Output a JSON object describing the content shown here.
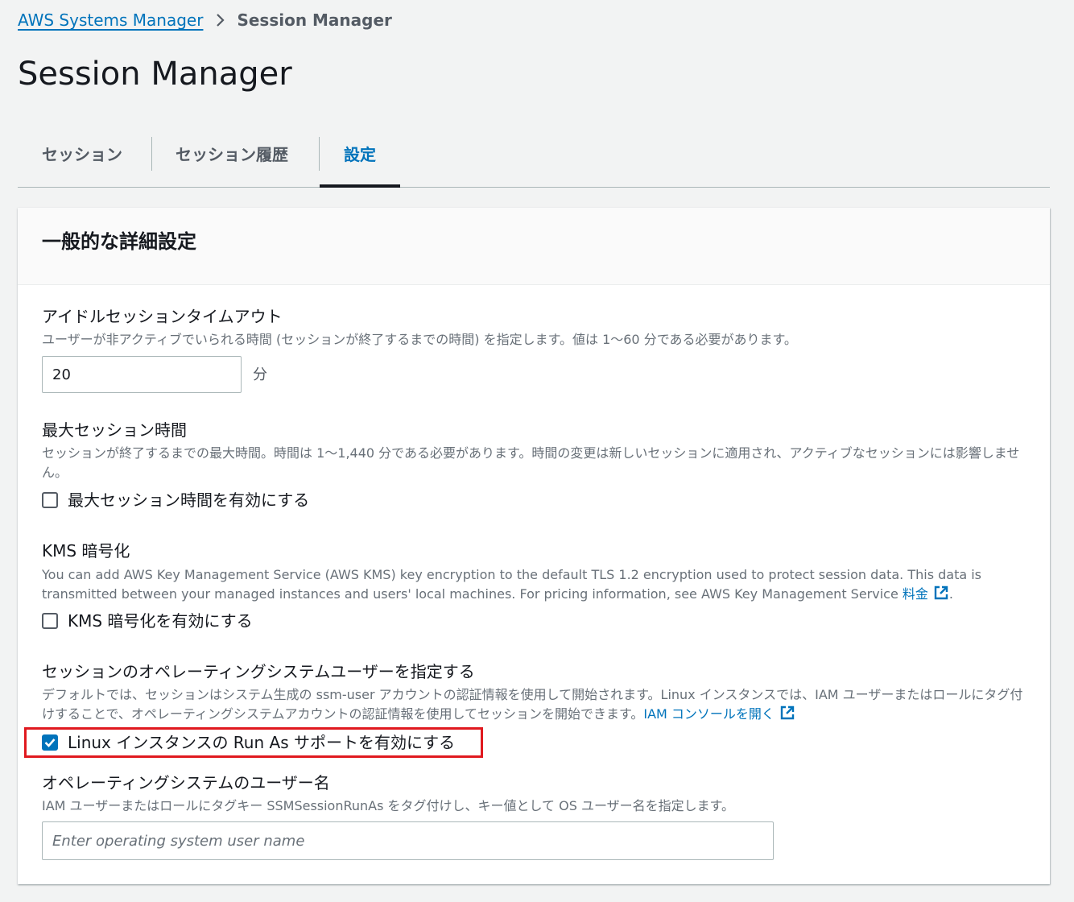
{
  "breadcrumb": {
    "parent": "AWS Systems Manager",
    "current": "Session Manager"
  },
  "page_title": "Session Manager",
  "tabs": [
    {
      "label": "セッション",
      "active": false
    },
    {
      "label": "セッション履歴",
      "active": false
    },
    {
      "label": "設定",
      "active": true
    }
  ],
  "card": {
    "title": "一般的な詳細設定"
  },
  "idle_timeout": {
    "label": "アイドルセッションタイムアウト",
    "description": "ユーザーが非アクティブでいられる時間 (セッションが終了するまでの時間) を指定します。値は 1〜60 分である必要があります。",
    "value": "20",
    "unit": "分"
  },
  "max_session": {
    "label": "最大セッション時間",
    "description": "セッションが終了するまでの最大時間。時間は 1〜1,440 分である必要があります。時間の変更は新しいセッションに適用され、アクティブなセッションには影響しません。",
    "checkbox_label": "最大セッション時間を有効にする",
    "checked": false
  },
  "kms": {
    "label": "KMS 暗号化",
    "description": "You can add AWS Key Management Service (AWS KMS) key encryption to the default TLS 1.2 encryption used to protect session data. This data is transmitted between your managed instances and users' local machines. For pricing information, see AWS Key Management Service",
    "link_text": "料金",
    "description_end": ".",
    "checkbox_label": "KMS 暗号化を有効にする",
    "checked": false
  },
  "run_as": {
    "label": "セッションのオペレーティングシステムユーザーを指定する",
    "description": "デフォルトでは、セッションはシステム生成の ssm-user アカウントの認証情報を使用して開始されます。Linux インスタンスでは、IAM ユーザーまたはロールにタグ付けすることで、オペレーティングシステムアカウントの認証情報を使用してセッションを開始できます。",
    "link_text": "IAM コンソールを開く",
    "checkbox_label": "Linux インスタンスの Run As サポートを有効にする",
    "checked": true
  },
  "os_user": {
    "label": "オペレーティングシステムのユーザー名",
    "description": "IAM ユーザーまたはロールにタグキー SSMSessionRunAs をタグ付けし、キー値として OS ユーザー名を指定します。",
    "placeholder": "Enter operating system user name",
    "value": ""
  },
  "colors": {
    "link": "#0073bb",
    "highlight": "#e0191f",
    "background": "#f2f3f3"
  }
}
